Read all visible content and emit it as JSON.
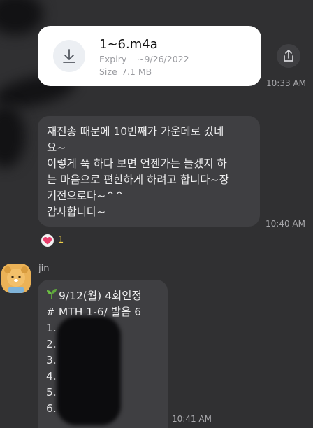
{
  "file_message": {
    "file_name": "1~6.m4a",
    "expiry_label": "Expiry",
    "expiry_value": "~9/26/2022",
    "size_label": "Size",
    "size_value": "7.1 MB",
    "download_icon": "download-icon",
    "share_icon": "share-icon",
    "time": "10:33 AM"
  },
  "text_message": {
    "lines": [
      "재전송 때문에 10번째가 가운데로 갔네",
      "요~",
      "이렇게 쭉 하다 보면 언젠가는 늘겠지 하",
      "는 마음으로 편한하게 하려고 합니다~장",
      "기전으로다~^^",
      "감사합니다~"
    ],
    "time": "10:40 AM",
    "reaction": {
      "icon": "heart-icon",
      "count": "1"
    }
  },
  "jin_message": {
    "sender": "jin",
    "lines": [
      "9/12(월) 4회인정",
      "# MTH 1-6/ 발음 6"
    ],
    "list_items": [
      "1.",
      "2.",
      "3.",
      "4.",
      "5.",
      "6."
    ],
    "time": "10:41 AM"
  },
  "colors": {
    "background": "#303032",
    "bubble": "#3f3f42",
    "file_bubble": "#ffffff",
    "reaction_count": "#f0d04a",
    "heart": "#e83d6b",
    "avatar": "#ebb257"
  }
}
